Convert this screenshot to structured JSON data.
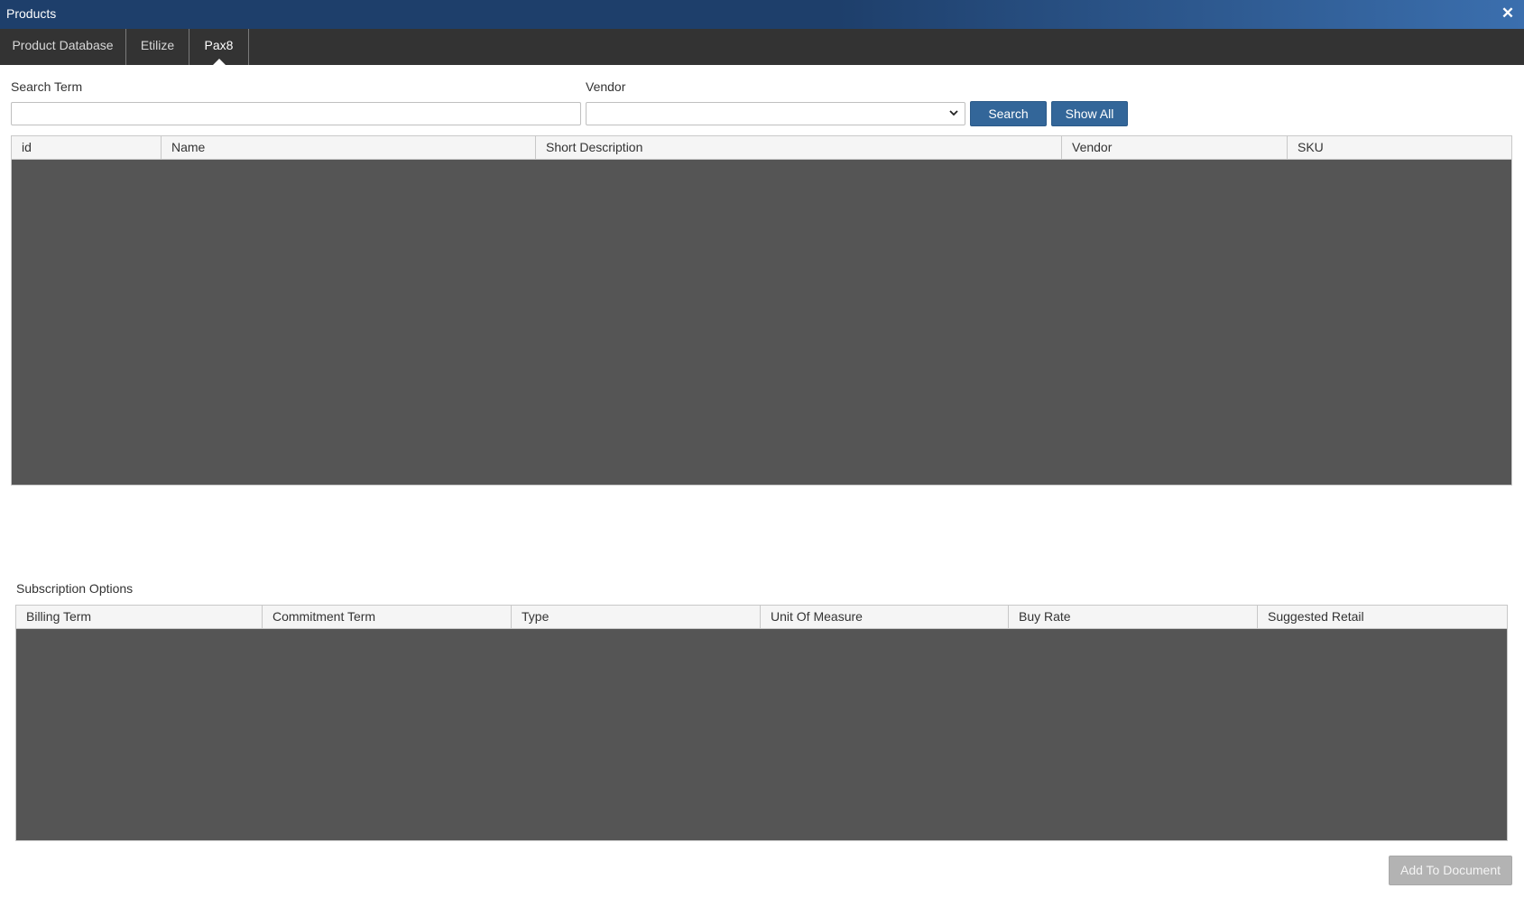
{
  "window": {
    "title": "Products",
    "close_icon": "close-icon"
  },
  "tabs": [
    {
      "label": "Product Database",
      "active": false
    },
    {
      "label": "Etilize",
      "active": false
    },
    {
      "label": "Pax8",
      "active": true
    }
  ],
  "search": {
    "term_label": "Search Term",
    "term_value": "",
    "vendor_label": "Vendor",
    "vendor_value": "",
    "search_button": "Search",
    "show_all_button": "Show All"
  },
  "products_grid": {
    "columns": [
      "id",
      "Name",
      "Short Description",
      "Vendor",
      "SKU"
    ],
    "rows": []
  },
  "subscription": {
    "title": "Subscription Options",
    "columns": [
      "Billing Term",
      "Commitment Term",
      "Type",
      "Unit Of Measure",
      "Buy Rate",
      "Suggested Retail"
    ],
    "rows": []
  },
  "footer": {
    "add_button": "Add To Document",
    "add_button_enabled": false
  },
  "colors": {
    "title_bar_start": "#1e3f6b",
    "title_bar_end": "#3b6fae",
    "tab_bar": "#333333",
    "primary_button": "#336699",
    "disabled_button": "#b3b3b3",
    "grid_body": "#555555",
    "grid_header": "#f5f5f5"
  }
}
